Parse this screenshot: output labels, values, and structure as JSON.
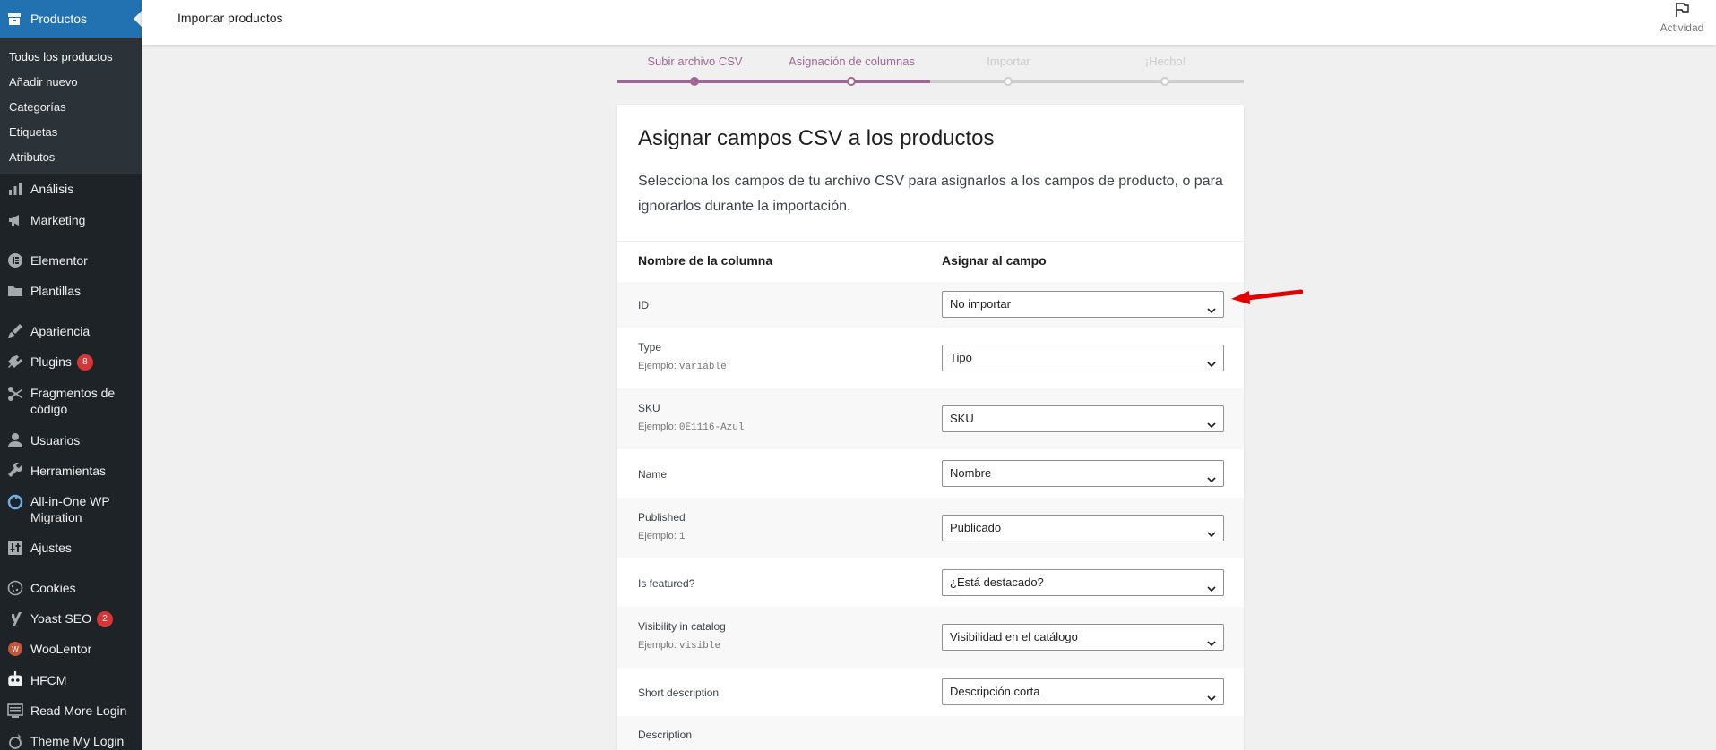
{
  "sidebar": {
    "active": "Productos",
    "submenu": [
      "Todos los productos",
      "Añadir nuevo",
      "Categorías",
      "Etiquetas",
      "Atributos"
    ],
    "items": [
      {
        "label": "Análisis",
        "icon": "chart-icon"
      },
      {
        "label": "Marketing",
        "icon": "megaphone-icon"
      },
      {
        "label": "Elementor",
        "icon": "elementor-icon"
      },
      {
        "label": "Plantillas",
        "icon": "folder-icon"
      },
      {
        "label": "Apariencia",
        "icon": "brush-icon"
      },
      {
        "label": "Plugins",
        "icon": "plugin-icon",
        "badge": "8"
      },
      {
        "label": "Fragmentos de código",
        "icon": "scissors-icon"
      },
      {
        "label": "Usuarios",
        "icon": "user-icon"
      },
      {
        "label": "Herramientas",
        "icon": "wrench-icon"
      },
      {
        "label": "All-in-One WP Migration",
        "icon": "migration-icon"
      },
      {
        "label": "Ajustes",
        "icon": "settings-icon"
      },
      {
        "label": "Cookies",
        "icon": "cookie-icon"
      },
      {
        "label": "Yoast SEO",
        "icon": "yoast-icon",
        "badge": "2"
      },
      {
        "label": "WooLentor",
        "icon": "woolentor-icon"
      },
      {
        "label": "HFCM",
        "icon": "robot-icon"
      },
      {
        "label": "Read More Login",
        "icon": "screen-icon"
      },
      {
        "label": "Theme My Login",
        "icon": "login-icon"
      }
    ]
  },
  "header": {
    "title": "Importar productos",
    "activity": "Actividad"
  },
  "steps": [
    "Subir archivo CSV",
    "Asignación de columnas",
    "Importar",
    "¡Hecho!"
  ],
  "card": {
    "title": "Asignar campos CSV a los productos",
    "description": "Selecciona los campos de tu archivo CSV para asignarlos a los campos de producto, o para ignorarlos durante la importación.",
    "col_name": "Nombre de la columna",
    "col_map": "Asignar al campo",
    "example_prefix": "Ejemplo:",
    "rows": [
      {
        "name": "ID",
        "example": "",
        "field": "No importar"
      },
      {
        "name": "Type",
        "example": "variable",
        "field": "Tipo"
      },
      {
        "name": "SKU",
        "example": "0E1116-Azul",
        "field": "SKU"
      },
      {
        "name": "Name",
        "example": "",
        "field": "Nombre"
      },
      {
        "name": "Published",
        "example": "1",
        "field": "Publicado"
      },
      {
        "name": "Is featured?",
        "example": "",
        "field": "¿Está destacado?"
      },
      {
        "name": "Visibility in catalog",
        "example": "visible",
        "field": "Visibilidad en el catálogo"
      },
      {
        "name": "Short description",
        "example": "",
        "field": "Descripción corta"
      },
      {
        "name": "Description",
        "example": "",
        "field": ""
      }
    ]
  },
  "colors": {
    "accent": "#a16696",
    "sidebar": "#1d2327",
    "active": "#2271b1",
    "annotation": "#e00000"
  }
}
